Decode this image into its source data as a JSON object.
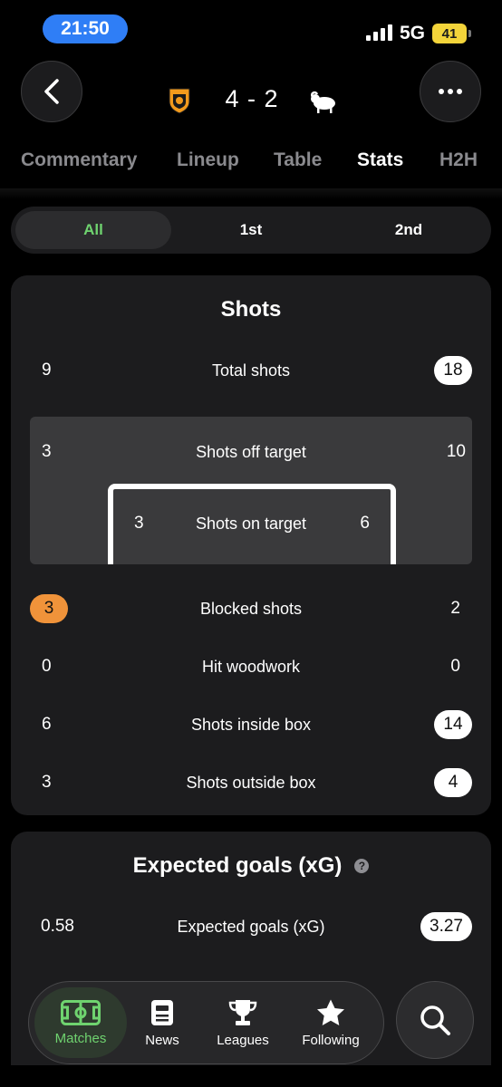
{
  "status_bar": {
    "time": "21:50",
    "network": "5G",
    "battery": "41"
  },
  "match": {
    "home_goals": "4",
    "away_goals": "2",
    "score_text": "4 - 2",
    "home_crest": "hull-city-crest",
    "away_crest": "derby-county-ram-crest"
  },
  "tabs": [
    {
      "label": "Commentary",
      "active": false
    },
    {
      "label": "Lineup",
      "active": false
    },
    {
      "label": "Table",
      "active": false
    },
    {
      "label": "Stats",
      "active": true
    },
    {
      "label": "H2H",
      "active": false
    }
  ],
  "periods": [
    {
      "label": "All",
      "active": true
    },
    {
      "label": "1st",
      "active": false
    },
    {
      "label": "2nd",
      "active": false
    }
  ],
  "shots": {
    "title": "Shots",
    "total_shots": {
      "label": "Total shots",
      "home": "9",
      "away": "18"
    },
    "shots_off_target": {
      "label": "Shots off target",
      "home": "3",
      "away": "10"
    },
    "shots_on_target": {
      "label": "Shots on target",
      "home": "3",
      "away": "6"
    },
    "blocked_shots": {
      "label": "Blocked shots",
      "home": "3",
      "away": "2"
    },
    "hit_woodwork": {
      "label": "Hit woodwork",
      "home": "0",
      "away": "0"
    },
    "shots_inside_box": {
      "label": "Shots inside box",
      "home": "6",
      "away": "14"
    },
    "shots_outside_box": {
      "label": "Shots outside box",
      "home": "3",
      "away": "4"
    }
  },
  "xg": {
    "title": "Expected goals (xG)",
    "expected_goals": {
      "label": "Expected goals (xG)",
      "home": "0.58",
      "away": "3.27"
    }
  },
  "bottom_nav": [
    {
      "label": "Matches",
      "icon": "pitch-icon",
      "active": true
    },
    {
      "label": "News",
      "icon": "news-icon",
      "active": false
    },
    {
      "label": "Leagues",
      "icon": "trophy-icon",
      "active": false
    },
    {
      "label": "Following",
      "icon": "star-icon",
      "active": false
    }
  ],
  "colors": {
    "accent_green": "#6fd36f",
    "highlight_orange": "#f0933a",
    "time_pill_blue": "#2f7ef6",
    "battery_yellow": "#f3d43a",
    "card_bg": "#1c1c1e"
  }
}
